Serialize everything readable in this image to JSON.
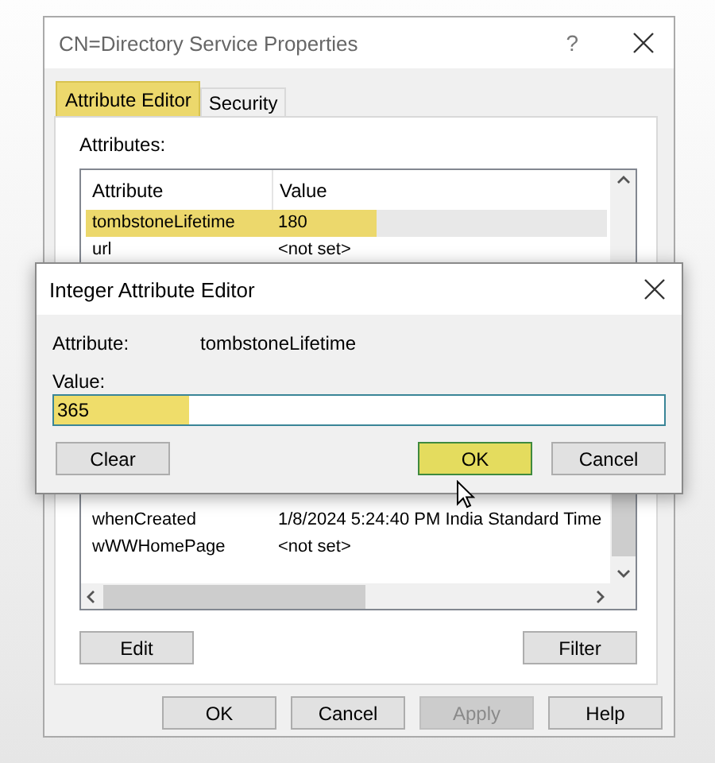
{
  "properties_window": {
    "title": "CN=Directory Service Properties",
    "help_label": "?",
    "tabs": [
      {
        "label": "Attribute Editor",
        "selected": true
      },
      {
        "label": "Security",
        "selected": false
      }
    ],
    "attributes_label": "Attributes:",
    "attribute_list": {
      "columns": [
        "Attribute",
        "Value"
      ],
      "upper_rows": [
        {
          "name": "tombstoneLifetime",
          "value": "180",
          "selected": true
        },
        {
          "name": "url",
          "value": "<not set>",
          "selected": false
        }
      ],
      "lower_rows": [
        {
          "name": "whenCreated",
          "value": "1/8/2024 5:24:40 PM India Standard Time",
          "selected": false
        },
        {
          "name": "wWWHomePage",
          "value": "<not set>",
          "selected": false
        }
      ]
    },
    "list_buttons": [
      "Edit",
      "Filter"
    ],
    "buttons": [
      {
        "label": "OK",
        "disabled": false
      },
      {
        "label": "Cancel",
        "disabled": false
      },
      {
        "label": "Apply",
        "disabled": true
      },
      {
        "label": "Help",
        "disabled": false
      }
    ]
  },
  "integer_dialog": {
    "title": "Integer Attribute Editor",
    "attribute_label": "Attribute:",
    "attribute_value": "tombstoneLifetime",
    "value_label": "Value:",
    "value_field": {
      "value": "365",
      "highlighted": true
    },
    "buttons": [
      {
        "label": "Clear",
        "highlighted": false
      },
      {
        "label": "OK",
        "highlighted": true
      },
      {
        "label": "Cancel",
        "highlighted": false
      }
    ]
  }
}
